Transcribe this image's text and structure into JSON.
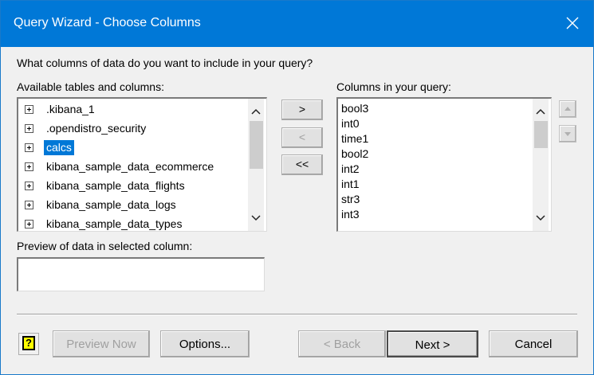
{
  "window": {
    "title": "Query Wizard - Choose Columns"
  },
  "prompt": "What columns of data do you want to include in your query?",
  "available": {
    "label": "Available tables and columns:",
    "items": [
      ".kibana_1",
      ".opendistro_security",
      "calcs",
      "kibana_sample_data_ecommerce",
      "kibana_sample_data_flights",
      "kibana_sample_data_logs",
      "kibana_sample_data_types"
    ],
    "selected": "calcs"
  },
  "move_buttons": {
    "add": ">",
    "remove": "<",
    "remove_all": "<<"
  },
  "query_columns": {
    "label": "Columns in your query:",
    "items": [
      "bool3",
      "int0",
      "time1",
      "bool2",
      "int2",
      "int1",
      "str3",
      "int3"
    ]
  },
  "preview": {
    "label": "Preview of data in selected column:",
    "value": ""
  },
  "buttons": {
    "preview_now": "Preview Now",
    "options": "Options...",
    "back": "< Back",
    "next": "Next >",
    "cancel": "Cancel"
  },
  "colors": {
    "titlebar": "#0078d7",
    "selection": "#0078d7",
    "help_icon": "#ffff00"
  }
}
